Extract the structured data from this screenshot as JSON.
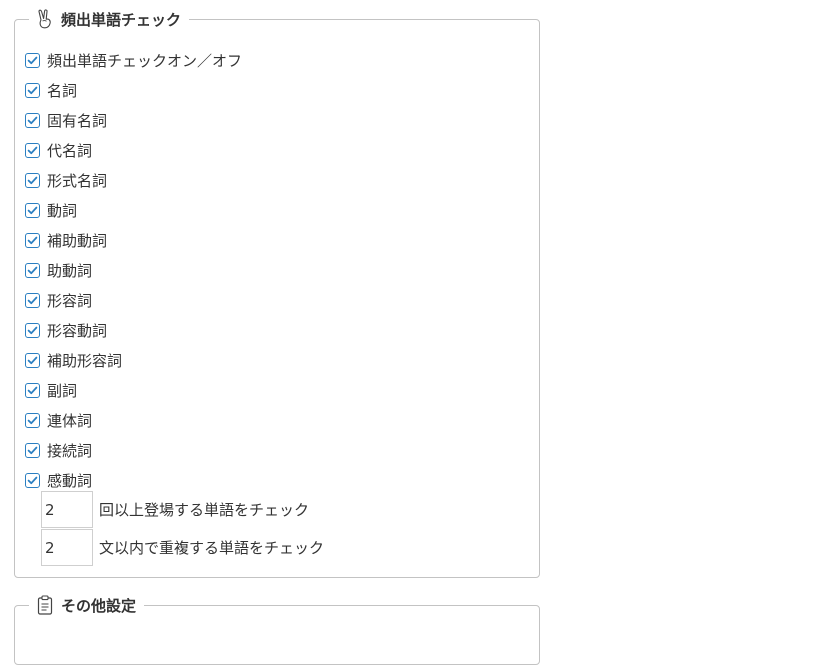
{
  "freq_section": {
    "title": "頻出単語チェック",
    "icon": "victory-hand-icon",
    "checkboxes": [
      {
        "label": "頻出単語チェックオン／オフ",
        "checked": true
      },
      {
        "label": "名詞",
        "checked": true
      },
      {
        "label": "固有名詞",
        "checked": true
      },
      {
        "label": "代名詞",
        "checked": true
      },
      {
        "label": "形式名詞",
        "checked": true
      },
      {
        "label": "動詞",
        "checked": true
      },
      {
        "label": "補助動詞",
        "checked": true
      },
      {
        "label": "助動詞",
        "checked": true
      },
      {
        "label": "形容詞",
        "checked": true
      },
      {
        "label": "形容動詞",
        "checked": true
      },
      {
        "label": "補助形容詞",
        "checked": true
      },
      {
        "label": "副詞",
        "checked": true
      },
      {
        "label": "連体詞",
        "checked": true
      },
      {
        "label": "接続詞",
        "checked": true
      },
      {
        "label": "感動詞",
        "checked": true
      }
    ],
    "min_count": {
      "value": "2",
      "label": "回以上登場する単語をチェック"
    },
    "duplicate_range": {
      "value": "2",
      "label": "文以内で重複する単語をチェック"
    }
  },
  "other_section": {
    "title": "その他設定",
    "icon": "clipboard-icon"
  },
  "colors": {
    "checkbox": "#2b7fc1",
    "border": "#c3c3c3",
    "text": "#333333"
  }
}
